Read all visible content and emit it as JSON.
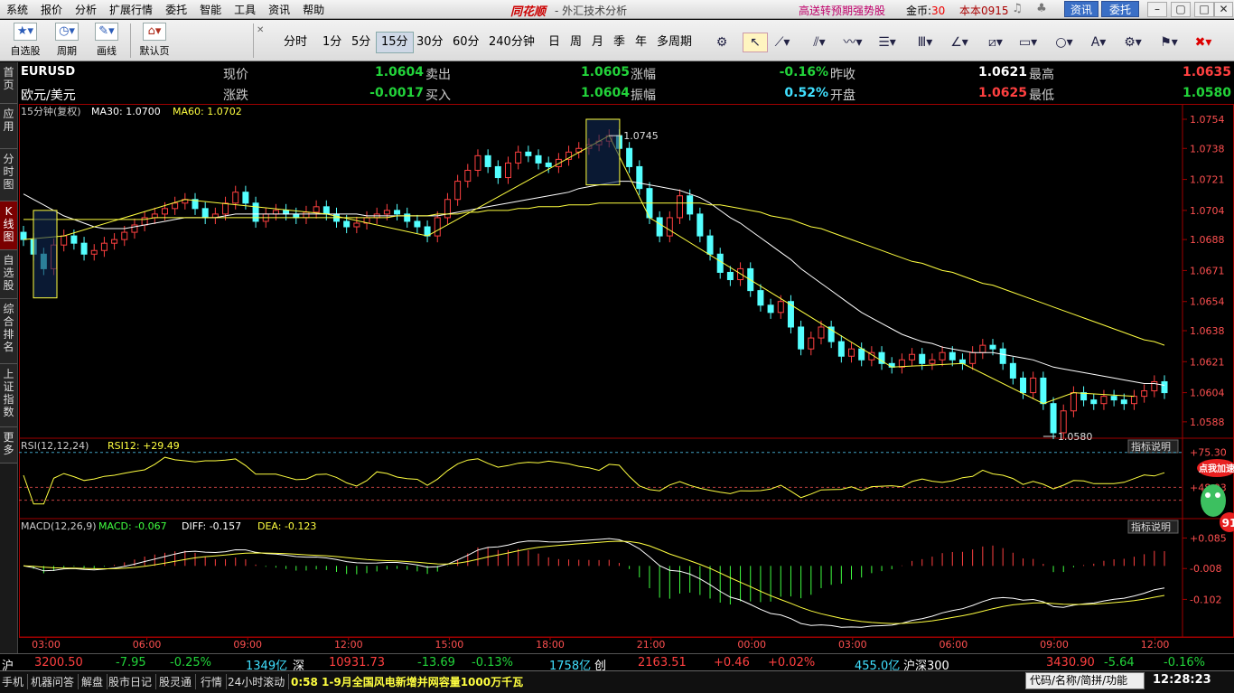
{
  "menu": [
    "系统",
    "报价",
    "分析",
    "扩展行情",
    "委托",
    "智能",
    "工具",
    "资讯",
    "帮助"
  ],
  "brand": "同花顺",
  "brand_sub": "- 外汇技术分析",
  "promo": "高送转预期强势股",
  "coins_label": "金币:",
  "coins_value": "30",
  "version": "本本0915",
  "btn_info": "资讯",
  "btn_order": "委托",
  "toolbar": {
    "self_select": "自选股",
    "period_btn": "周期",
    "draw_btn": "画线",
    "default_page": "默认页",
    "periods": [
      "分时",
      "1分",
      "5分",
      "15分",
      "30分",
      "60分",
      "240分钟",
      "日",
      "周",
      "月",
      "季",
      "年",
      "多周期"
    ],
    "active_period": "15分"
  },
  "sidebar": [
    {
      "label": "首页",
      "active": false
    },
    {
      "label": "应用",
      "active": false
    },
    {
      "label": "分时图",
      "active": false
    },
    {
      "label": "K线图",
      "active": true
    },
    {
      "label": "自选股",
      "active": false
    },
    {
      "label": "综合排名",
      "active": false
    },
    {
      "label": "上证指数",
      "active": false
    },
    {
      "label": "更多",
      "active": false
    }
  ],
  "quote": {
    "code": "EURUSD",
    "name": "欧元/美元",
    "row1": [
      {
        "label": "现价",
        "value": "1.0604",
        "color": "g"
      },
      {
        "label": "卖出",
        "value": "1.0605",
        "color": "g"
      },
      {
        "label": "涨幅",
        "value": "-0.16%",
        "color": "g"
      },
      {
        "label": "昨收",
        "value": "1.0621",
        "color": "w"
      },
      {
        "label": "最高",
        "value": "1.0635",
        "color": "r"
      }
    ],
    "row2": [
      {
        "label": "涨跌",
        "value": "-0.0017",
        "color": "g"
      },
      {
        "label": "买入",
        "value": "1.0604",
        "color": "g"
      },
      {
        "label": "振幅",
        "value": "0.52%",
        "color": "c"
      },
      {
        "label": "开盘",
        "value": "1.0625",
        "color": "r"
      },
      {
        "label": "最低",
        "value": "1.0580",
        "color": "g"
      }
    ]
  },
  "main_panel": {
    "title": "15分钟(复权)",
    "ma30_label": "MA30: 1.0700",
    "ma60_label": "MA60: 1.0702",
    "y_ticks": [
      "1.0754",
      "1.0738",
      "1.0721",
      "1.0704",
      "1.0688",
      "1.0671",
      "1.0654",
      "1.0638",
      "1.0621",
      "1.0604",
      "1.0588"
    ],
    "high_mark": "1.0745",
    "low_mark": "1.0580"
  },
  "rsi_panel": {
    "title": "RSI(12,12,24)",
    "value_label": "RSI12: +29.49",
    "y_ticks": [
      "+75.30",
      "+48.03"
    ],
    "help": "指标说明"
  },
  "macd_panel": {
    "title": "MACD(12,26,9)",
    "macd_label": "MACD: -0.067",
    "diff_label": "DIFF: -0.157",
    "dea_label": "DEA: -0.123",
    "y_ticks": [
      "+0.085",
      "-0.008",
      "-0.102"
    ],
    "help": "指标说明"
  },
  "x_ticks": [
    "03:00",
    "06:00",
    "09:00",
    "12:00",
    "15:00",
    "18:00",
    "21:00",
    "00:00",
    "03:00",
    "06:00",
    "09:00",
    "12:00"
  ],
  "sticker_text": "点我加速",
  "sticker_badge": "91",
  "bottom": {
    "sh_label": "沪",
    "sh_value": "3200.50",
    "sh_change": "-7.95",
    "sh_pct": "-0.25%",
    "sh_amount": "1349亿",
    "sz_label": "深",
    "sz_value": "10931.73",
    "sz_change": "-13.69",
    "sz_pct": "-0.13%",
    "sz_amount": "1758亿",
    "cy_label": "创",
    "cy_value": "2163.51",
    "cy_change": "+0.46",
    "cy_pct": "+0.02%",
    "cy_amount": "455.0亿",
    "hs_label": "沪深300",
    "hs_value": "3430.90",
    "hs_change": "-5.64",
    "hs_pct": "-0.16%"
  },
  "statusbar": {
    "items": [
      "手机",
      "机器问答",
      "解盘",
      "股市日记",
      "股灵通",
      "行情",
      "24小时滚动"
    ],
    "news": "0:58 1-9月全国风电新增并网容量1000万千瓦",
    "search_placeholder": "代码/名称/简拼/功能",
    "clock": "12:28:23"
  },
  "chart_data": {
    "type": "candlestick",
    "interval": "15min",
    "ylim": [
      1.058,
      1.0754
    ],
    "close": [
      1.0688,
      1.068,
      1.0672,
      1.0685,
      1.069,
      1.0686,
      1.068,
      1.0682,
      1.0686,
      1.0688,
      1.0692,
      1.0696,
      1.07,
      1.0702,
      1.0705,
      1.0708,
      1.071,
      1.0705,
      1.07,
      1.0702,
      1.0708,
      1.0714,
      1.0708,
      1.0698,
      1.0702,
      1.0704,
      1.0702,
      1.07,
      1.0703,
      1.0706,
      1.0702,
      1.0698,
      1.0695,
      1.0697,
      1.07,
      1.0702,
      1.0704,
      1.0702,
      1.0698,
      1.0695,
      1.069,
      1.07,
      1.071,
      1.072,
      1.0726,
      1.0734,
      1.0728,
      1.0722,
      1.073,
      1.0736,
      1.0734,
      1.073,
      1.0728,
      1.0732,
      1.0736,
      1.0738,
      1.074,
      1.0742,
      1.0745,
      1.0738,
      1.0728,
      1.0716,
      1.07,
      1.069,
      1.07,
      1.0712,
      1.0702,
      1.069,
      1.068,
      1.067,
      1.0666,
      1.0672,
      1.066,
      1.0652,
      1.0648,
      1.0654,
      1.064,
      1.0628,
      1.0634,
      1.064,
      1.0632,
      1.0624,
      1.0628,
      1.0622,
      1.0626,
      1.062,
      1.0618,
      1.0622,
      1.0625,
      1.062,
      1.0622,
      1.0626,
      1.0622,
      1.062,
      1.0626,
      1.063,
      1.0628,
      1.062,
      1.0612,
      1.0604,
      1.0612,
      1.0598,
      1.0582,
      1.0594,
      1.0604,
      1.06,
      1.0598,
      1.0602,
      1.06,
      1.0598,
      1.0602,
      1.0605,
      1.061,
      1.0604
    ],
    "ma30": [
      1.0713,
      1.071,
      1.0707,
      1.0704,
      1.0701,
      1.0699,
      1.0697,
      1.0695,
      1.0694,
      1.0694,
      1.0694,
      1.0695,
      1.0696,
      1.0697,
      1.0698,
      1.0699,
      1.07,
      1.07,
      1.07,
      1.07,
      1.0701,
      1.0702,
      1.0702,
      1.0702,
      1.0702,
      1.0702,
      1.0702,
      1.0702,
      1.0702,
      1.0702,
      1.0702,
      1.0702,
      1.0702,
      1.0702,
      1.0701,
      1.0701,
      1.0701,
      1.0701,
      1.0701,
      1.0701,
      1.0701,
      1.0701,
      1.0702,
      1.0703,
      1.0704,
      1.0705,
      1.0706,
      1.0707,
      1.0708,
      1.0709,
      1.071,
      1.0711,
      1.0712,
      1.0713,
      1.0714,
      1.0716,
      1.0717,
      1.0718,
      1.0719,
      1.072,
      1.072,
      1.0719,
      1.0718,
      1.0717,
      1.0716,
      1.0715,
      1.0713,
      1.0711,
      1.0708,
      1.0704,
      1.07,
      1.0697,
      1.0693,
      1.0689,
      1.0685,
      1.0681,
      1.0677,
      1.0672,
      1.0668,
      1.0664,
      1.066,
      1.0656,
      1.0652,
      1.0648,
      1.0645,
      1.0642,
      1.0639,
      1.0636,
      1.0634,
      1.0632,
      1.0631,
      1.0629,
      1.0628,
      1.0627,
      1.0626,
      1.0626,
      1.0626,
      1.0625,
      1.0624,
      1.0623,
      1.0622,
      1.062,
      1.0618,
      1.0617,
      1.0616,
      1.0615,
      1.0614,
      1.0613,
      1.0612,
      1.0611,
      1.061,
      1.0609,
      1.0609,
      1.0608
    ],
    "ma60": [
      1.0699,
      1.0699,
      1.0699,
      1.0699,
      1.0699,
      1.0699,
      1.0699,
      1.0699,
      1.0699,
      1.0699,
      1.0699,
      1.0699,
      1.0699,
      1.07,
      1.07,
      1.07,
      1.07,
      1.07,
      1.07,
      1.07,
      1.07,
      1.07,
      1.07,
      1.07,
      1.07,
      1.07,
      1.07,
      1.07,
      1.07,
      1.07,
      1.07,
      1.07,
      1.07,
      1.07,
      1.07,
      1.07,
      1.07,
      1.0701,
      1.0701,
      1.0701,
      1.0701,
      1.0702,
      1.0702,
      1.0702,
      1.0703,
      1.0703,
      1.0704,
      1.0704,
      1.0704,
      1.0705,
      1.0705,
      1.0706,
      1.0706,
      1.0706,
      1.0707,
      1.0707,
      1.0707,
      1.0708,
      1.0708,
      1.0708,
      1.0708,
      1.0708,
      1.0708,
      1.0708,
      1.0708,
      1.0708,
      1.0708,
      1.0708,
      1.0707,
      1.0707,
      1.0706,
      1.0705,
      1.0704,
      1.0703,
      1.0701,
      1.07,
      1.0699,
      1.0697,
      1.0695,
      1.0694,
      1.0692,
      1.069,
      1.0688,
      1.0686,
      1.0684,
      1.0682,
      1.068,
      1.0678,
      1.0676,
      1.0675,
      1.0673,
      1.0671,
      1.067,
      1.0668,
      1.0666,
      1.0664,
      1.0663,
      1.0661,
      1.0659,
      1.0657,
      1.0655,
      1.0653,
      1.0651,
      1.0649,
      1.0647,
      1.0645,
      1.0643,
      1.0641,
      1.0639,
      1.0637,
      1.0635,
      1.0633,
      1.0632,
      1.063
    ],
    "rsi_ticks": [
      75.3,
      48.03
    ],
    "macd_ticks": [
      0.085,
      -0.008,
      -0.102
    ]
  }
}
